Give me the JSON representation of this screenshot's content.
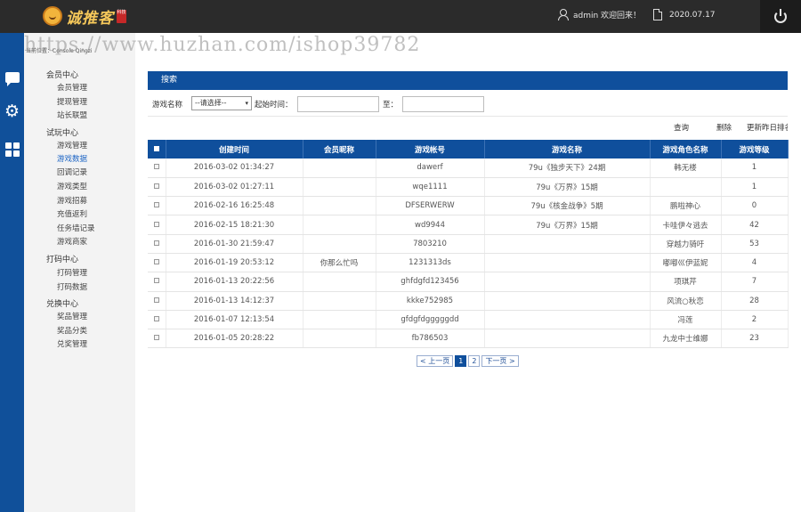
{
  "brand": {
    "name": "诚推客",
    "seal": "科技"
  },
  "header": {
    "user_text": "admin 欢迎回来！",
    "date": "2020.07.17"
  },
  "watermark": "https://www.huzhan.com/ishop39782",
  "breadcrumb": "当前位置：Console Qingzi",
  "sidebar": {
    "groups": [
      {
        "label": "会员中心",
        "items": [
          "会员管理",
          "提现管理",
          "站长联盟"
        ]
      },
      {
        "label": "试玩中心",
        "items": [
          "游戏管理",
          "游戏数据",
          "回调记录",
          "游戏类型",
          "游戏招募",
          "充值返利",
          "任务墙记录",
          "游戏商家"
        ]
      },
      {
        "label": "打码中心",
        "items": [
          "打码管理",
          "打码数据"
        ]
      },
      {
        "label": "兑换中心",
        "items": [
          "奖品管理",
          "奖品分类",
          "兑奖管理"
        ]
      }
    ],
    "active_item": "游戏数据"
  },
  "panel": {
    "title": "搜索"
  },
  "search": {
    "game_label": "游戏名称",
    "game_select_value": "--请选择--",
    "start_label": "起始时间：",
    "end_label": "至："
  },
  "actions": {
    "query": "查询",
    "delete": "删除",
    "update": "更新昨日排名"
  },
  "table": {
    "headers": [
      "创建时间",
      "会员昵称",
      "游戏帐号",
      "游戏名称",
      "游戏角色名称",
      "游戏等级"
    ],
    "rows": [
      [
        "2016-03-02 01:34:27",
        "",
        "dawerf",
        "79u《独步天下》24期",
        "韩无楼",
        "1"
      ],
      [
        "2016-03-02 01:27:11",
        "",
        "wqe1111",
        "79u《万界》15期",
        "",
        "1"
      ],
      [
        "2016-02-16 16:25:48",
        "",
        "DFSERWERW",
        "79u《核金战争》5期",
        "鹏啦神心",
        "0"
      ],
      [
        "2016-02-15 18:21:30",
        "",
        "wd9944",
        "79u《万界》15期",
        "卡哇伊々逃去",
        "42"
      ],
      [
        "2016-01-30 21:59:47",
        "",
        "7803210",
        "",
        "穿越力骑吁",
        "53"
      ],
      [
        "2016-01-19 20:53:12",
        "你那么忙吗",
        "1231313ds",
        "",
        "嘟嘟巛伊蓝妮",
        "4"
      ],
      [
        "2016-01-13 20:22:56",
        "",
        "ghfdgfd123456",
        "",
        "项琪芹",
        "7"
      ],
      [
        "2016-01-13 14:12:37",
        "",
        "kkke752985",
        "",
        "风流○秋恋",
        "28"
      ],
      [
        "2016-01-07 12:13:54",
        "",
        "gfdgfdgggggdd",
        "",
        "冯莲",
        "2"
      ],
      [
        "2016-01-05 20:28:22",
        "",
        "fb786503",
        "",
        "九龙中士维娜",
        "23"
      ]
    ]
  },
  "pager": {
    "prev": "< 上一页",
    "pages": [
      "1",
      "2"
    ],
    "current": "1",
    "next": "下一页 >"
  }
}
